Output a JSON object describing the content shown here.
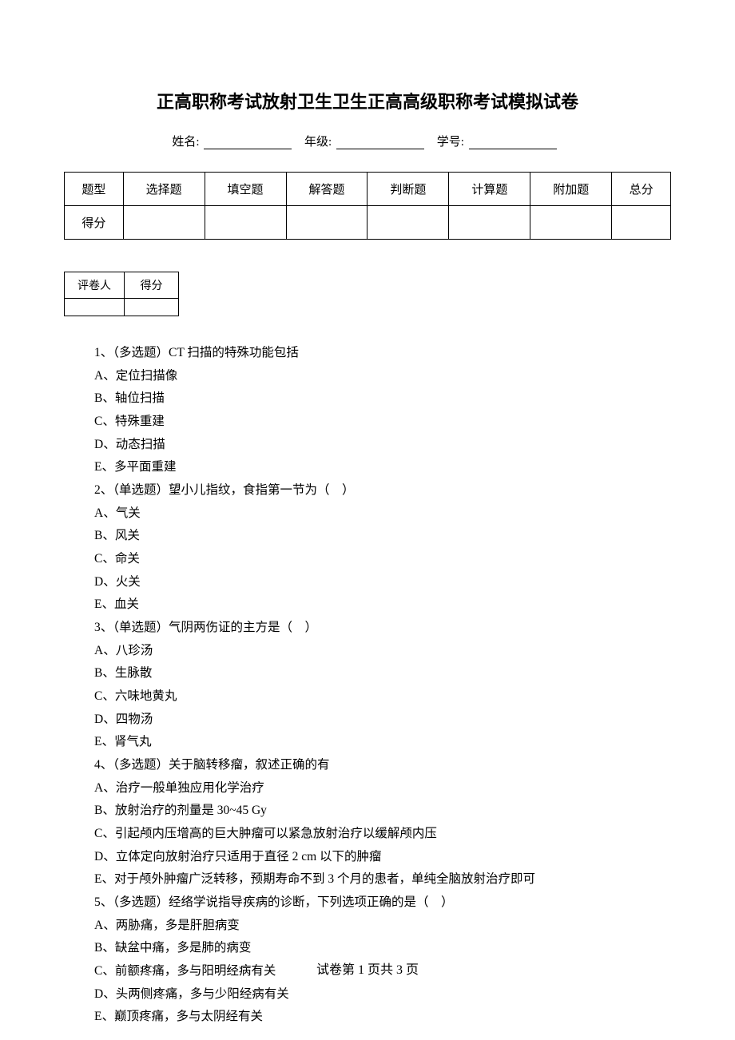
{
  "title": "正高职称考试放射卫生卫生正高高级职称考试模拟试卷",
  "info": {
    "name_label": "姓名:",
    "grade_label": "年级:",
    "id_label": "学号:"
  },
  "score_headers": [
    "题型",
    "选择题",
    "填空题",
    "解答题",
    "判断题",
    "计算题",
    "附加题",
    "总分"
  ],
  "score_row_label": "得分",
  "grader": {
    "reviewer_label": "评卷人",
    "score_label": "得分"
  },
  "questions": [
    "1、（多选题）CT 扫描的特殊功能包括",
    "A、定位扫描像",
    "B、轴位扫描",
    "C、特殊重建",
    "D、动态扫描",
    "E、多平面重建",
    "2、（单选题）望小儿指纹，食指第一节为（　）",
    "A、气关",
    "B、风关",
    "C、命关",
    "D、火关",
    "E、血关",
    "3、（单选题）气阴两伤证的主方是（　）",
    "A、八珍汤",
    "B、生脉散",
    "C、六味地黄丸",
    "D、四物汤",
    "E、肾气丸",
    "4、（多选题）关于脑转移瘤，叙述正确的有",
    "A、治疗一般单独应用化学治疗",
    "B、放射治疗的剂量是 30~45 Gy",
    "C、引起颅内压增高的巨大肿瘤可以紧急放射治疗以缓解颅内压",
    "D、立体定向放射治疗只适用于直径 2 cm 以下的肿瘤",
    "E、对于颅外肿瘤广泛转移，预期寿命不到 3 个月的患者，单纯全脑放射治疗即可",
    "5、（多选题）经络学说指导疾病的诊断，下列选项正确的是（　）",
    "A、两胁痛，多是肝胆病变",
    "B、缺盆中痛，多是肺的病变",
    "C、前额疼痛，多与阳明经病有关",
    "D、头两侧疼痛，多与少阳经病有关",
    "E、巅顶疼痛，多与太阴经有关"
  ],
  "footer": "试卷第 1 页共 3 页"
}
